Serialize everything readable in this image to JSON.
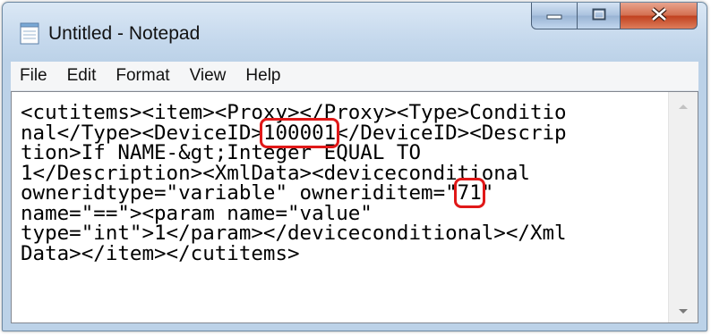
{
  "window": {
    "title": "Untitled - Notepad"
  },
  "menu": [
    "File",
    "Edit",
    "Format",
    "View",
    "Help"
  ],
  "editor": {
    "lines": [
      [
        {
          "t": "<cutitems><item><Proxy></Proxy><Type>Conditio"
        }
      ],
      [
        {
          "t": "nal</Type><DeviceID>"
        },
        {
          "t": "100001",
          "hl": true
        },
        {
          "t": "</DeviceID><Descrip"
        }
      ],
      [
        {
          "t": "tion>If NAME-&gt;Integer EQUAL TO"
        }
      ],
      [
        {
          "t": "1</Description><XmlData><deviceconditional"
        }
      ],
      [
        {
          "t": "owneridtype=\"variable\" owneriditem=\""
        },
        {
          "t": "71",
          "hl": true
        },
        {
          "t": "\""
        }
      ],
      [
        {
          "t": "name=\"==\"><param name=\"value\""
        }
      ],
      [
        {
          "t": "type=\"int\">1</param></deviceconditional></Xml"
        }
      ],
      [
        {
          "t": "Data></item></cutitems>"
        }
      ]
    ]
  },
  "icons": {
    "app": "notepad-icon",
    "minimize": "minimize-icon",
    "maximize": "maximize-icon",
    "close": "close-icon",
    "scroll_up": "scroll-up-arrow-icon",
    "scroll_down": "scroll-down-arrow-icon"
  },
  "colors": {
    "highlight": "#e01818",
    "close_button": "#c94a2a"
  }
}
